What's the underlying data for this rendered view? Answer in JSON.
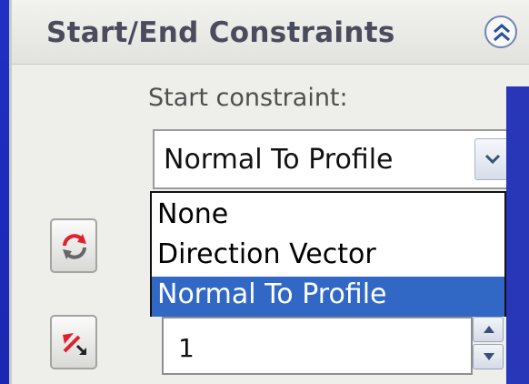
{
  "panel": {
    "title": "Start/End Constraints",
    "collapse_icon": "double-chevron-up-icon"
  },
  "start_constraint": {
    "label": "Start constraint:",
    "selected": "Normal To Profile",
    "options": [
      "None",
      "Direction Vector",
      "Normal To Profile"
    ],
    "highlighted_index": 2
  },
  "buttons": {
    "reverse_icon": "reverse-direction-icon",
    "direction_icon": "direction-arrow-icon"
  },
  "number_field": {
    "value": "1"
  },
  "colors": {
    "background_blue": "#1f2bb8",
    "selection_blue": "#3168c6",
    "icon_red": "#e0202a"
  }
}
